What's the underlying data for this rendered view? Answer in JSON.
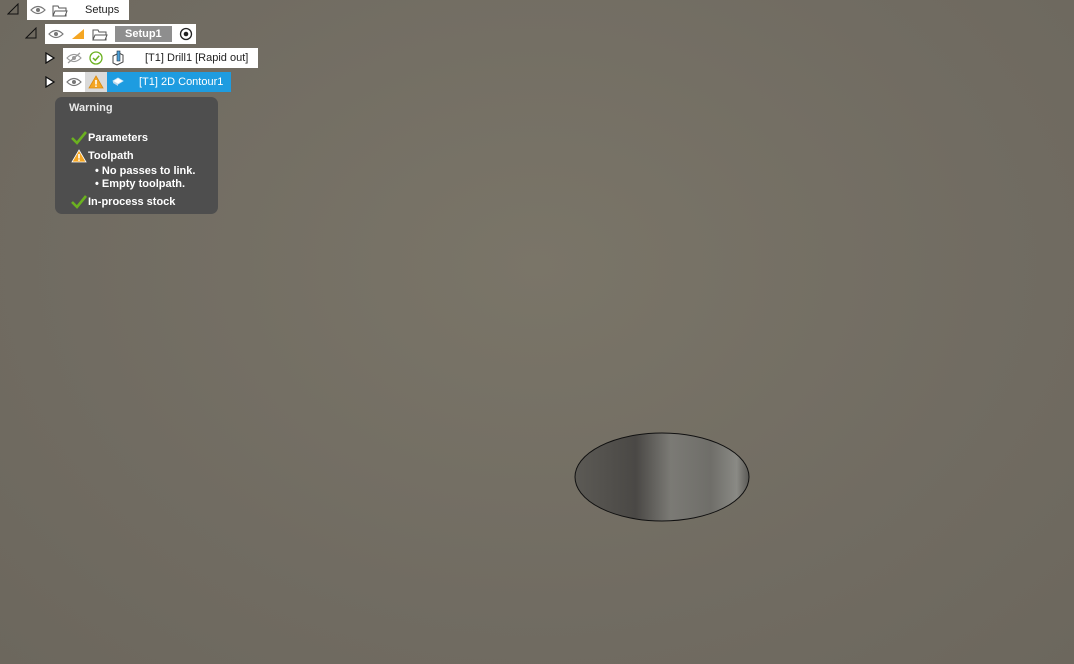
{
  "tree": {
    "root": {
      "label": "Setups"
    },
    "setup": {
      "label": "Setup1"
    },
    "operations": [
      {
        "label": "[T1] Drill1 [Rapid out]",
        "status": "ok",
        "visible": false,
        "selected": false
      },
      {
        "label": "[T1] 2D Contour1",
        "status": "warning",
        "visible": true,
        "selected": true
      }
    ]
  },
  "tooltip": {
    "title": "Warning",
    "items": [
      {
        "label": "Parameters",
        "status": "ok"
      },
      {
        "label": "Toolpath",
        "status": "warning"
      },
      {
        "label": "In-process stock",
        "status": "ok"
      }
    ],
    "details": [
      "No passes to link.",
      "Empty toolpath."
    ]
  },
  "colors": {
    "viewport": "#716c62",
    "selection": "#1e9ce0",
    "warning": "#f5a623",
    "ok": "#6bb120"
  }
}
